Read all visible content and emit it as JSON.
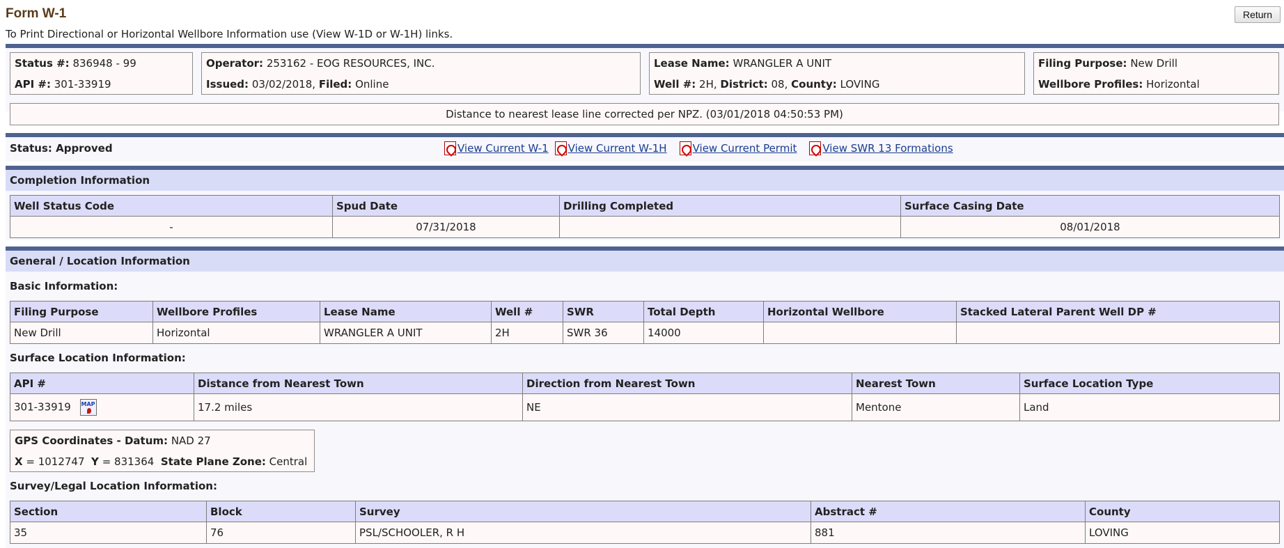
{
  "header": {
    "title": "Form W-1",
    "return_label": "Return",
    "subtitle": "To Print Directional or Horizontal Wellbore Information use (View W-1D or W-1H) links."
  },
  "summary": {
    "status_no_label": "Status #:",
    "status_no": "836948 - 99",
    "api_label": "API #:",
    "api": "301-33919",
    "operator_label": "Operator:",
    "operator": "253162 - EOG RESOURCES, INC.",
    "issued_label": "Issued:",
    "issued": "03/02/2018,",
    "filed_label": "Filed:",
    "filed": "Online",
    "lease_label": "Lease Name:",
    "lease": "WRANGLER A UNIT",
    "well_label": "Well #:",
    "well": "2H,",
    "district_label": "District:",
    "district": "08,",
    "county_label": "County:",
    "county": "LOVING",
    "filing_purpose_label": "Filing Purpose:",
    "filing_purpose": "New Drill",
    "wellbore_label": "Wellbore Profiles:",
    "wellbore": "Horizontal",
    "note": "Distance to nearest lease line corrected per NPZ. (03/01/2018 04:50:53 PM)"
  },
  "status_bar": {
    "status": "Status: Approved",
    "links": [
      "View Current W-1",
      "View Current W-1H",
      "View Current Permit",
      "View SWR 13 Formations"
    ],
    "icon": "pdf-icon"
  },
  "completion": {
    "heading": "Completion Information",
    "columns": [
      "Well Status Code",
      "Spud Date",
      "Drilling Completed",
      "Surface Casing Date"
    ],
    "row": [
      "-",
      "07/31/2018",
      "",
      "08/01/2018"
    ]
  },
  "general": {
    "heading": "General / Location Information",
    "basic_heading": "Basic Information:",
    "basic_columns": [
      "Filing Purpose",
      "Wellbore Profiles",
      "Lease Name",
      "Well #",
      "SWR",
      "Total Depth",
      "Horizontal Wellbore",
      "Stacked Lateral Parent Well DP #"
    ],
    "basic_row": [
      "New Drill",
      "Horizontal",
      "WRANGLER A UNIT",
      "2H",
      "SWR 36",
      "14000",
      "",
      ""
    ],
    "surface_heading": "Surface Location Information:",
    "surface_columns": [
      "API #",
      "Distance from Nearest Town",
      "Direction from Nearest Town",
      "Nearest Town",
      "Surface Location Type"
    ],
    "surface_row": [
      "301-33919",
      "17.2 miles",
      "NE",
      "Mentone",
      "Land"
    ],
    "map_icon_text": "MAP",
    "gps_label": "GPS Coordinates - Datum:",
    "gps_datum": "NAD 27",
    "x_label": "X",
    "x_value": "= 1012747",
    "y_label": "Y",
    "y_value": "= 831364",
    "zone_label": "State Plane Zone:",
    "zone": "Central",
    "survey_heading": "Survey/Legal Location Information:",
    "survey_columns": [
      "Section",
      "Block",
      "Survey",
      "Abstract #",
      "County"
    ],
    "survey_row": [
      "35",
      "76",
      "PSL/SCHOOLER, R H",
      "881",
      "LOVING"
    ]
  }
}
